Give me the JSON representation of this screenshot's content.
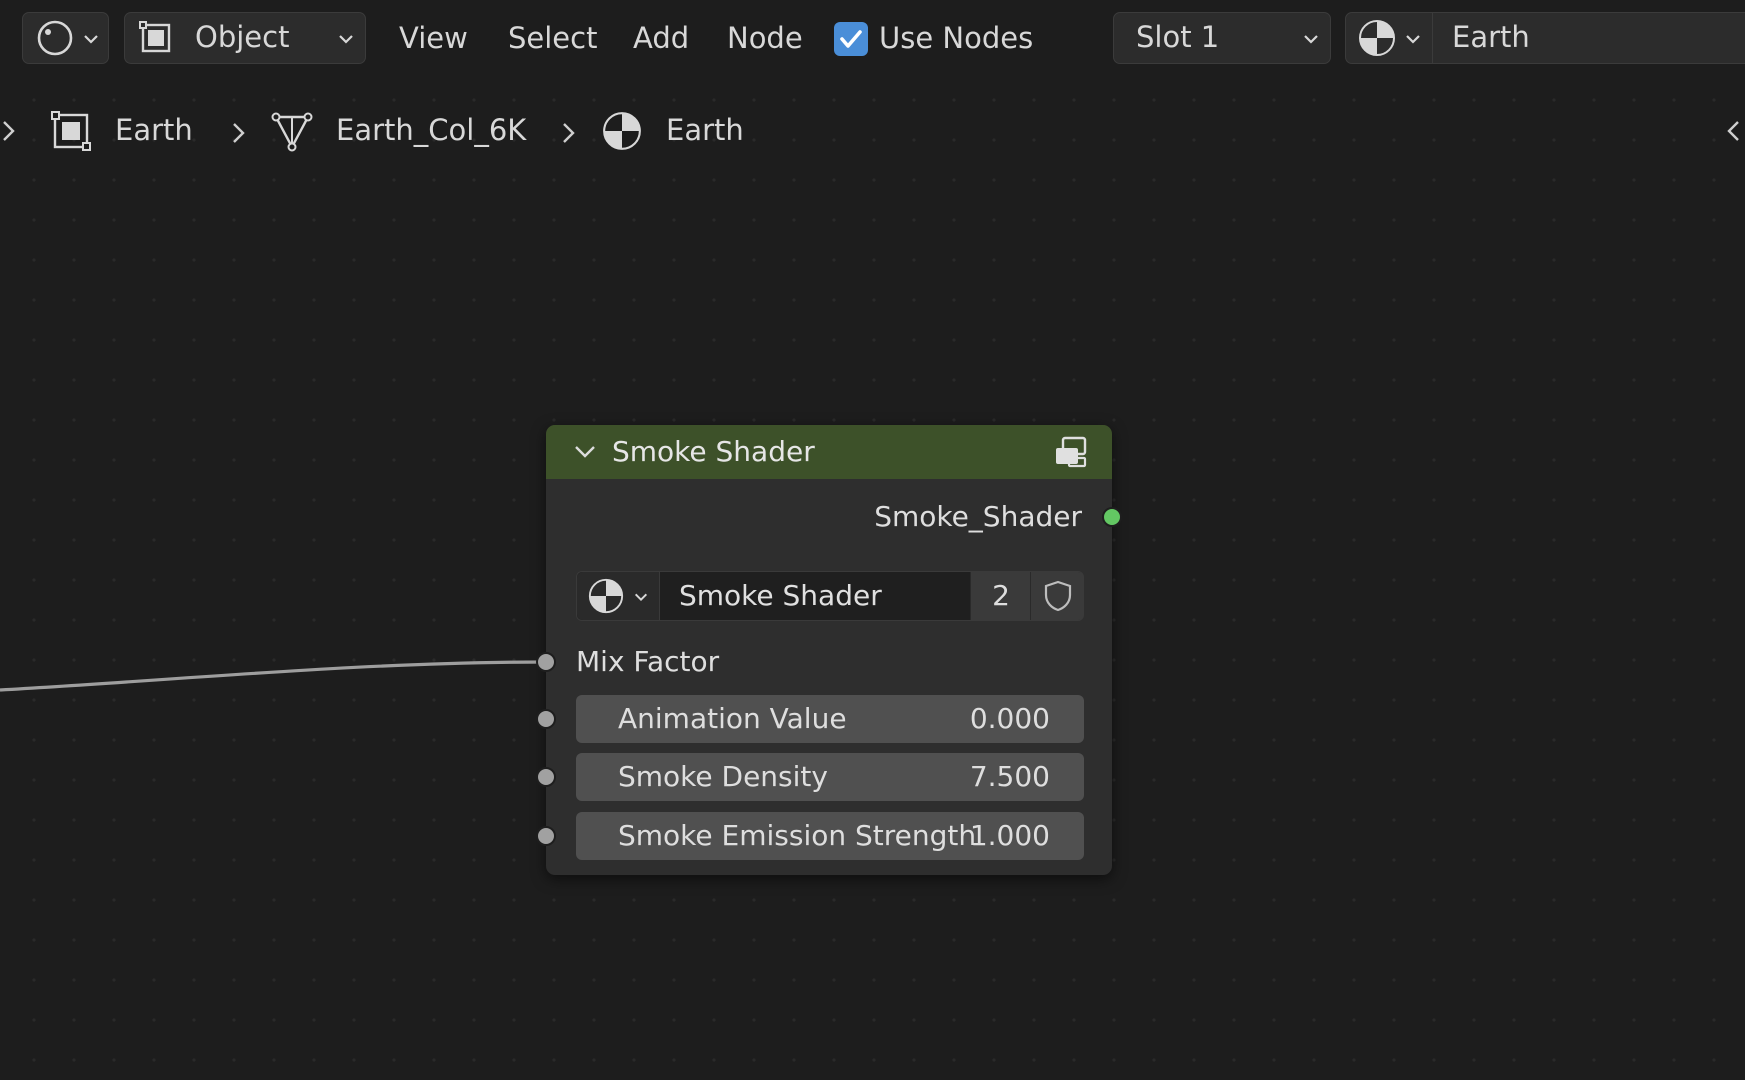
{
  "header": {
    "editor_type_icon": "node-editor-icon",
    "mode_icon": "object-mode-icon",
    "mode_label": "Object",
    "menus": [
      "View",
      "Select",
      "Add",
      "Node"
    ],
    "use_nodes_label": "Use Nodes",
    "use_nodes_checked": true,
    "slot_label": "Slot 1",
    "material_icon": "material-sphere-icon",
    "material_name": "Earth"
  },
  "breadcrumb": {
    "items": [
      {
        "icon": "object-icon",
        "label": "Earth"
      },
      {
        "icon": "mesh-icon",
        "label": "Earth_Col_6K"
      },
      {
        "icon": "material-sphere-icon",
        "label": "Earth"
      }
    ]
  },
  "node": {
    "title": "Smoke Shader",
    "header_color": "#3d5129",
    "output_label": "Smoke_Shader",
    "output_socket_color": "#63c763",
    "group_selector": {
      "icon": "material-sphere-icon",
      "name": "Smoke Shader",
      "users": "2",
      "fake_user_icon": "shield-icon"
    },
    "inputs": [
      {
        "label": "Mix Factor"
      },
      {
        "label": "Animation Value",
        "value": "0.000"
      },
      {
        "label": "Smoke Density",
        "value": "7.500"
      },
      {
        "label": "Smoke Emission Strength",
        "value": "1.000"
      }
    ]
  }
}
